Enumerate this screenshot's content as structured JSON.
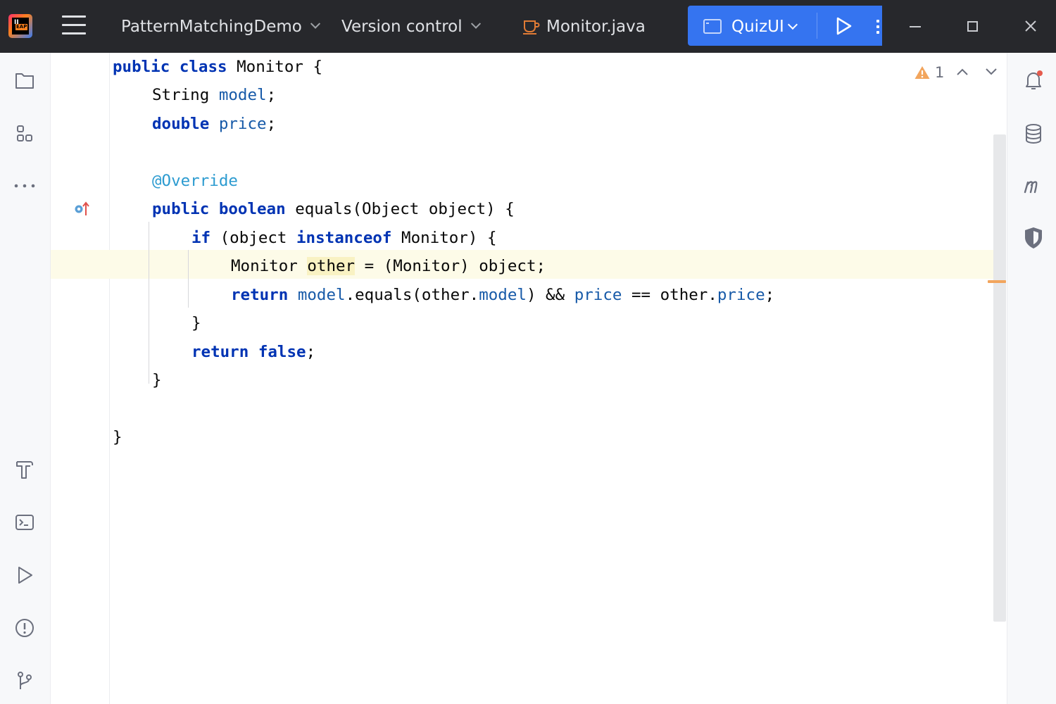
{
  "titlebar": {
    "logo_text": "IJ",
    "logo_badge": "EAP",
    "project_name": "PatternMatchingDemo",
    "vcs_label": "Version control",
    "file_name": "Monitor.java",
    "run_config": "QuizUI"
  },
  "left_tools": [
    "project-icon",
    "structure-icon",
    "more-icon",
    "build-icon",
    "terminal-icon",
    "run-icon",
    "problems-icon",
    "git-icon"
  ],
  "right_tools": [
    "notifications-icon",
    "database-icon",
    "maven-icon",
    "security-icon"
  ],
  "editor": {
    "inspection_count": "1",
    "lines": {
      "l1_kw": "public class ",
      "l1_rest": "Monitor {",
      "l2_type": "String ",
      "l2_field": "model",
      "l2_end": ";",
      "l3_kw": "double ",
      "l3_field": "price",
      "l3_end": ";",
      "l5_ann": "@Override",
      "l6_kw": "public boolean ",
      "l6_rest": "equals(Object object) {",
      "l7_kw1": "if ",
      "l7_mid": "(object ",
      "l7_kw2": "instanceof ",
      "l7_rest": "Monitor) {",
      "l8_type": "Monitor ",
      "l8_var": "other",
      "l8_rest": " = (Monitor) object;",
      "l9_kw": "return ",
      "l9_f1": "model",
      "l9_a": ".equals(other.",
      "l9_f2": "model",
      "l9_b": ") && ",
      "l9_f3": "price",
      "l9_c": " == other.",
      "l9_f4": "price",
      "l9_d": ";",
      "l10": "}",
      "l11_kw": "return false",
      "l11_end": ";",
      "l12": "}",
      "l14": "}"
    }
  },
  "colors": {
    "titlebar_bg": "#27282c",
    "run_accent": "#3574f0",
    "keyword": "#0033b3",
    "field": "#175aa8",
    "annotation": "#2c9bd0",
    "caret_row": "#fdfbe8",
    "highlight": "#f9f2c3",
    "warning": "#f2a55d"
  }
}
